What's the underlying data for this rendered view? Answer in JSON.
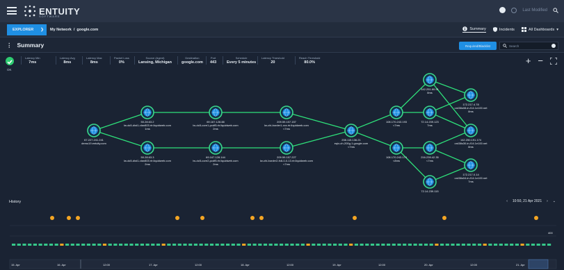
{
  "topbar": {
    "logo_text": "ENTUITY",
    "logo_sub": "SOFTWARE",
    "user_placeholder": "Last Modified"
  },
  "crumbbar": {
    "explorer_label": "EXPLORER",
    "network": "My Network",
    "separator": "/",
    "current": "google.com",
    "tabs": [
      {
        "label": "Summary",
        "icon": "info-icon",
        "active": true
      },
      {
        "label": "Incidents",
        "icon": "shield-icon",
        "active": false
      },
      {
        "label": "All Dashboards",
        "icon": "dashboard-icon",
        "active": false
      }
    ]
  },
  "summary": {
    "title": "Summary",
    "required_button": "Required/Blacklist",
    "search_placeholder": "Search"
  },
  "stats": {
    "status": "OK",
    "items": [
      {
        "label": "Latency Min",
        "value": "7ms"
      },
      {
        "label": "Latency Avg",
        "value": "8ms"
      },
      {
        "label": "Latency Max",
        "value": "8ms"
      },
      {
        "label": "Packet Loss",
        "value": "0%"
      },
      {
        "label": "Source (Agent)",
        "value": "Lansing, Michigan"
      },
      {
        "label": "Destination",
        "value": "google.com"
      },
      {
        "label": "Port",
        "value": "443"
      },
      {
        "label": "Schedule",
        "value": "Every 5 minutes"
      },
      {
        "label": "Latency Threshold",
        "value": "20"
      },
      {
        "label": "Reach Threshold",
        "value": "80.0%"
      }
    ]
  },
  "nodes": [
    {
      "id": "n0",
      "l1": "67.227.241.241",
      "l2": "demo19.entuity.com"
    },
    {
      "id": "n1",
      "l1": "50.28.63.2",
      "l2": "lw-dc5-dist1-vlan803.rtr.liquidweb.com",
      "l3": "1ms"
    },
    {
      "id": "n2",
      "l1": "50.28.63.3",
      "l2": "lw-dc5-dist1-vlan803.rtr.liquidweb.com",
      "l3": "2ms"
    },
    {
      "id": "n3",
      "l1": "69.167.128.88",
      "l2": "lw-dc5-core1-pcdf5.rtr.liquidweb.com",
      "l3": "2ms"
    },
    {
      "id": "n4",
      "l1": "69.167.128.144",
      "l2": "lw-dc5-core2-pcdf5.rtr.liquidweb.com",
      "l3": "2ms"
    },
    {
      "id": "n5",
      "l1": "209.59.157.157",
      "l2": "lw-chi-border1-xxx.rtr.liquidweb.com",
      "l3": "<7ms"
    },
    {
      "id": "n6",
      "l1": "209.59.157.227",
      "l2": "lw-chi-border2-fx8-0-0-13.rtr.liquidweb.com",
      "l3": "<7ms"
    },
    {
      "id": "n7",
      "l1": "208.115.136.21",
      "l2": "eqix-ch-200g-1.google.com",
      "l3": "<7ms"
    },
    {
      "id": "n8",
      "l1": "108.170.243.193",
      "l2": "<7ms"
    },
    {
      "id": "n9",
      "l1": "108.170.243.174",
      "l2": "<8ms"
    },
    {
      "id": "n10",
      "l1": "142.251.60.91",
      "l2": "8ms"
    },
    {
      "id": "n11",
      "l1": "72.14.239.123",
      "l2": "7ms"
    },
    {
      "id": "n12",
      "l1": "216.239.42.35",
      "l2": "<7ms"
    },
    {
      "id": "n13",
      "l1": "72.14.239.115",
      "l2": ""
    },
    {
      "id": "n14",
      "l1": "172.217.4.78",
      "l2": "ord38s08-in-f14.1e100.net",
      "l3": "8ms"
    },
    {
      "id": "n15",
      "l1": "142.250.191.174",
      "l2": "ord38s30-in-f14.1e100.net",
      "l3": "8ms"
    },
    {
      "id": "n16",
      "l1": "172.217.0.14",
      "l2": "ord38s04-in-f14.1e100.net",
      "l3": "7ms"
    }
  ],
  "history": {
    "title": "History",
    "timestamp": "10:50, 21 Apr 2021",
    "axis_value": "400",
    "timeline_labels": [
      "15. Apr",
      "16. Apr",
      "12:00",
      "17. Apr",
      "12:00",
      "18. Apr",
      "12:00",
      "19. Apr",
      "12:00",
      "20. Apr",
      "12:00",
      "21. Apr"
    ]
  },
  "colors": {
    "accent": "#1f8fe3",
    "ok": "#2ecc71",
    "node_ring": "#39d98a",
    "node_fill": "#1f8fe3",
    "link": "#2ee07a",
    "event": "#f5a623",
    "bar_ok": "#36c98a",
    "bar_warn": "#f5a623"
  }
}
